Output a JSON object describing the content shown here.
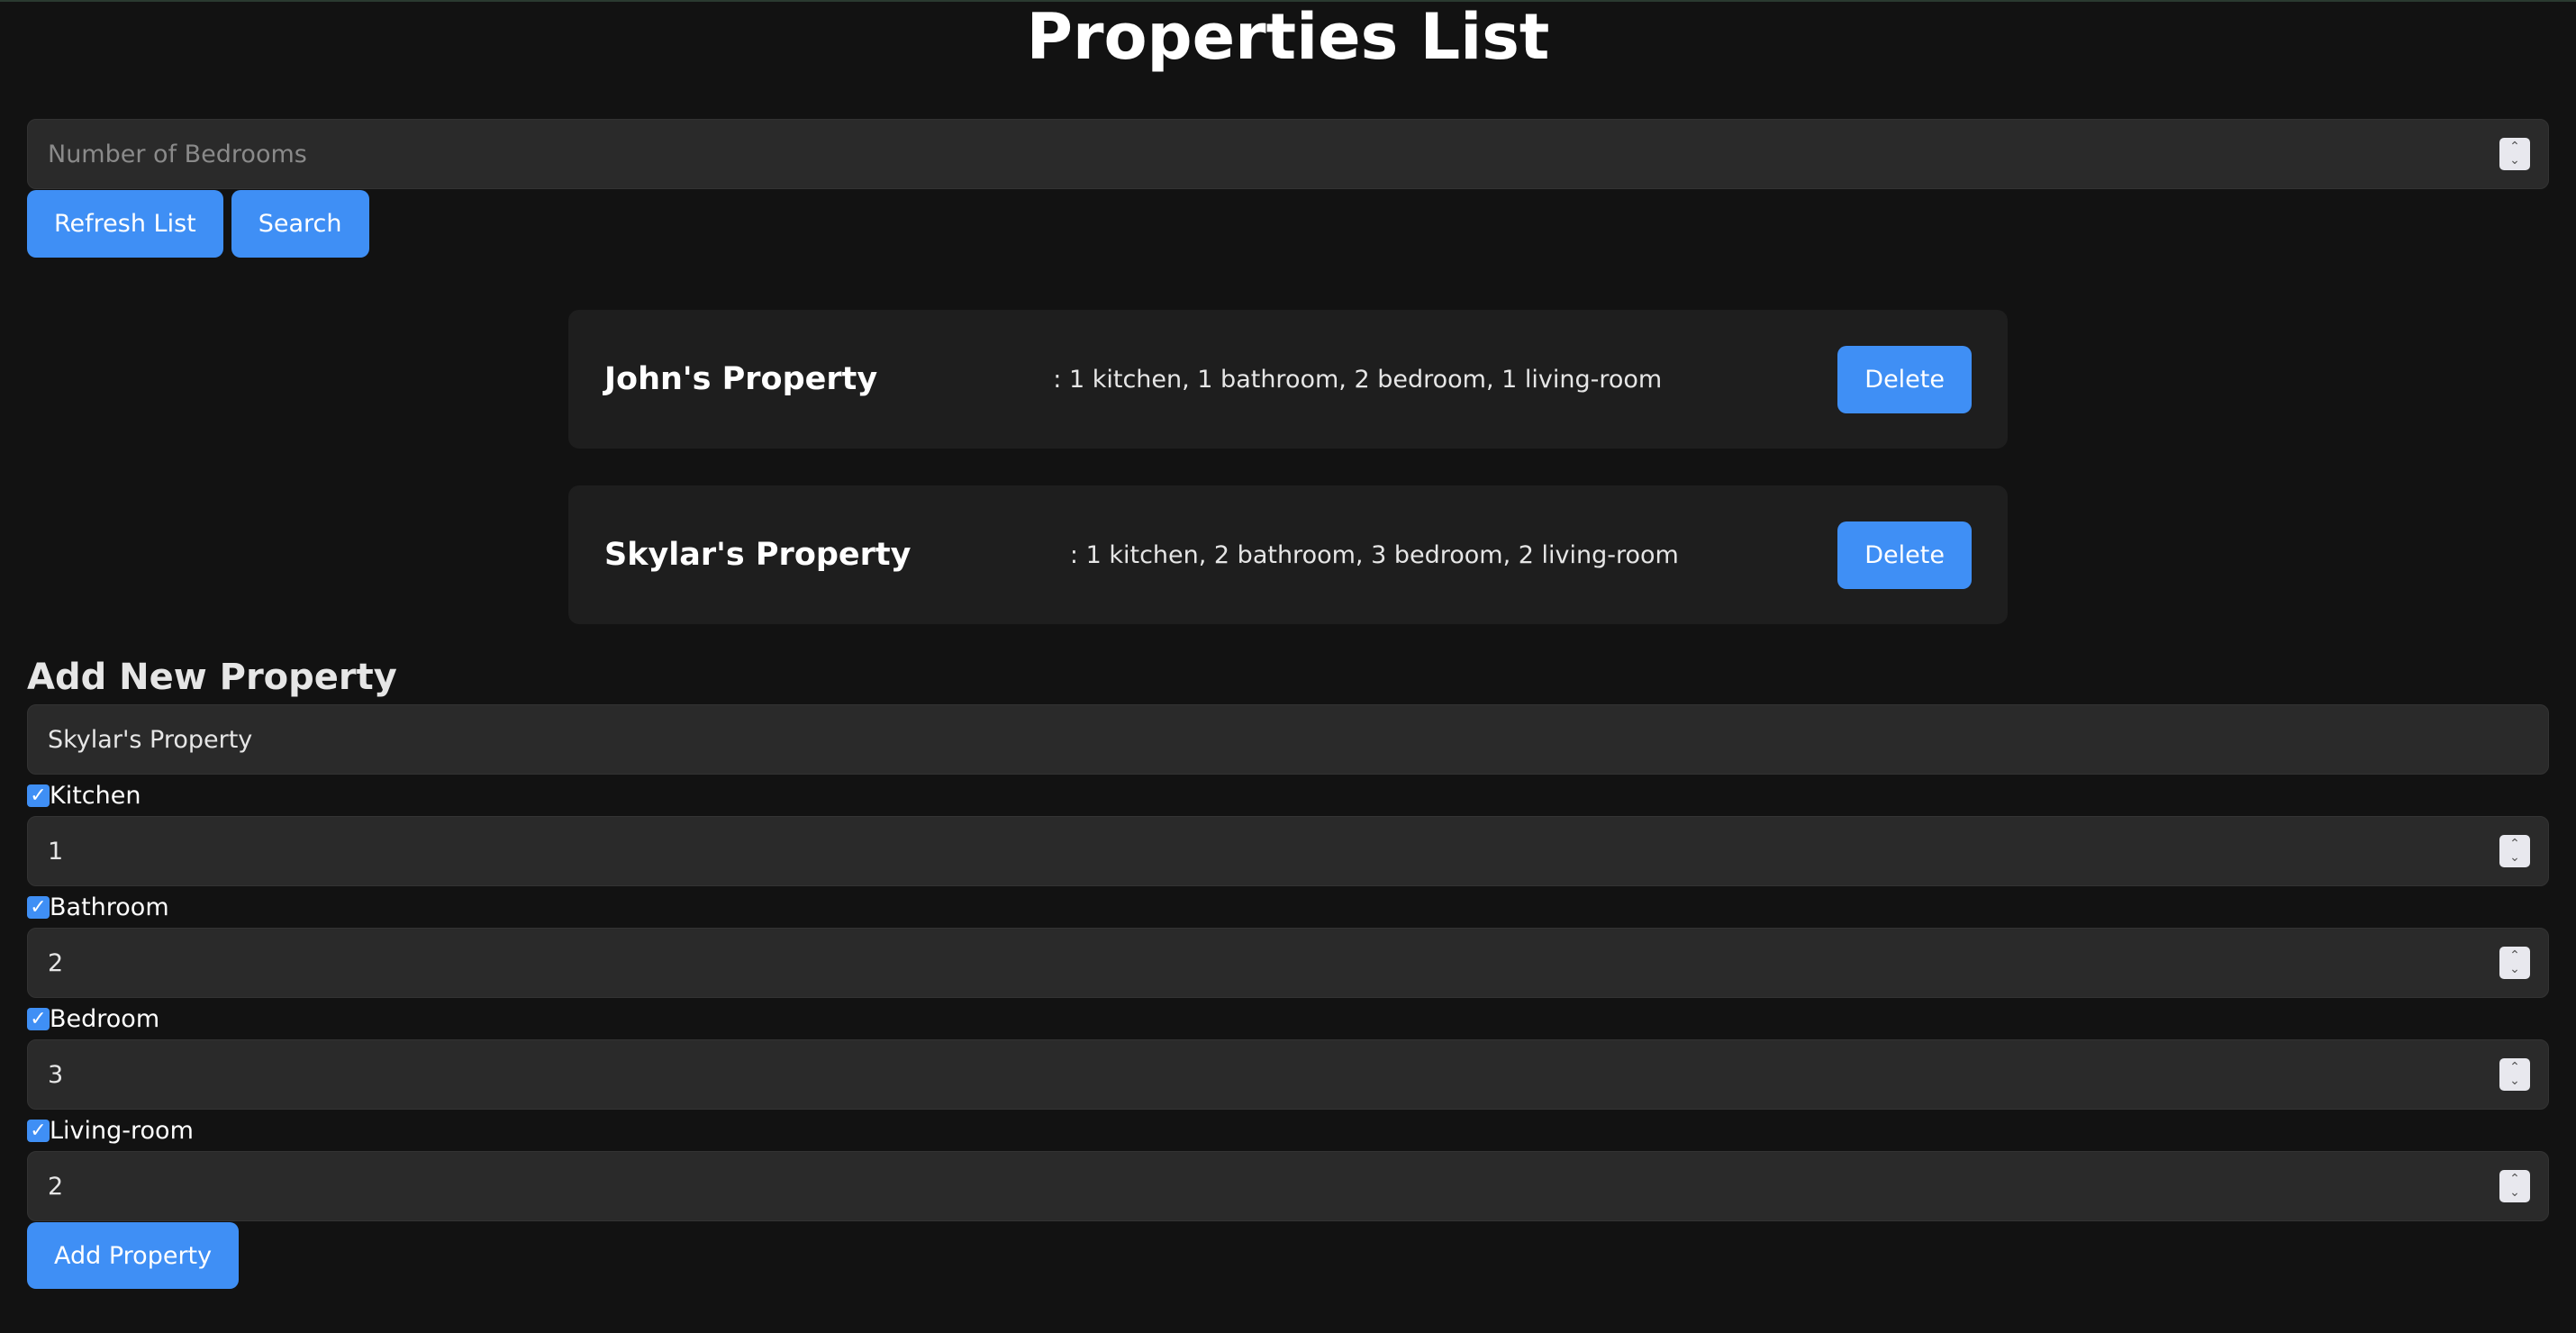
{
  "header": {
    "title": "Properties List"
  },
  "search": {
    "placeholder": "Number of Bedrooms",
    "refresh_label": "Refresh List",
    "search_label": "Search"
  },
  "properties": [
    {
      "name": "John's Property",
      "details": ": 1 kitchen, 1 bathroom, 2 bedroom, 1 living-room",
      "delete_label": "Delete"
    },
    {
      "name": "Skylar's Property",
      "details": ": 1 kitchen, 2 bathroom, 3 bedroom, 2 living-room",
      "delete_label": "Delete"
    }
  ],
  "form": {
    "title": "Add New Property",
    "name_value": "Skylar's Property",
    "rooms": [
      {
        "label": "Kitchen",
        "checked": true,
        "value": "1"
      },
      {
        "label": "Bathroom",
        "checked": true,
        "value": "2"
      },
      {
        "label": "Bedroom",
        "checked": true,
        "value": "3"
      },
      {
        "label": "Living-room",
        "checked": true,
        "value": "2"
      }
    ],
    "submit_label": "Add Property"
  },
  "colors": {
    "accent": "#3f8ff5",
    "background": "#121212",
    "card": "#1e1e1e",
    "input": "#2a2a2a"
  }
}
